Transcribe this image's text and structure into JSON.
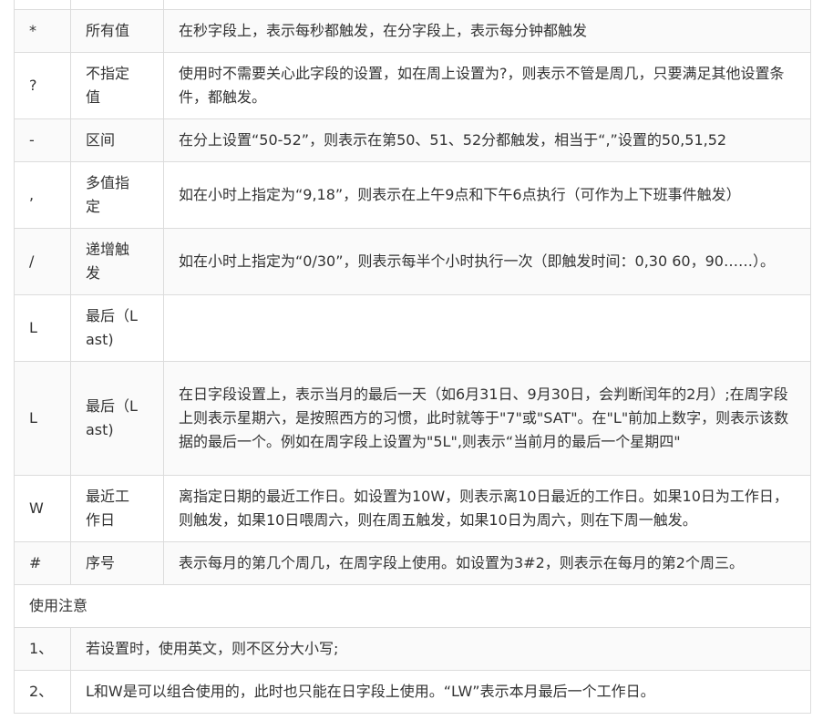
{
  "rows": [
    {
      "symbol": "",
      "name": "",
      "desc": ""
    },
    {
      "symbol": "*",
      "name": "所有值",
      "desc": "在秒字段上，表示每秒都触发，在分字段上，表示每分钟都触发"
    },
    {
      "symbol": "?",
      "name": "不指定值",
      "desc": "使用时不需要关心此字段的设置，如在周上设置为?，则表示不管是周几，只要满足其他设置条件，都触发。"
    },
    {
      "symbol": "-",
      "name": "区间",
      "desc": "在分上设置“50-52”，则表示在第50、51、52分都触发，相当于“,”设置的50,51,52"
    },
    {
      "symbol": ",",
      "name": "多值指定",
      "desc": "如在小时上指定为“9,18”，则表示在上午9点和下午6点执行（可作为上下班事件触发）"
    },
    {
      "symbol": "/",
      "name": "递增触发",
      "desc": "如在小时上指定为“0/30”，则表示每半个小时执行一次（即触发时间：0,30 60，90……）。"
    },
    {
      "symbol": "L",
      "name": "最后（Last)",
      "desc": ""
    },
    {
      "symbol": "L",
      "name": "最后（Last)",
      "desc": "在日字段设置上，表示当月的最后一天（如6月31日、9月30日，会判断闰年的2月）;在周字段上则表示星期六，是按照西方的习惯，此时就等于\"7\"或\"SAT\"。在\"L\"前加上数字，则表示该数据的最后一个。例如在周字段上设置为\"5L\",则表示“当前月的最后一个星期四\""
    },
    {
      "symbol": "W",
      "name": "最近工作日",
      "desc": "离指定日期的最近工作日。如设置为10W，则表示离10日最近的工作日。如果10日为工作日，则触发，如果10日喂周六，则在周五触发，如果10日为周六，则在下周一触发。"
    },
    {
      "symbol": "#",
      "name": "序号",
      "desc": "表示每月的第几个周几，在周字段上使用。如设置为3#2，则表示在每月的第2个周三。"
    }
  ],
  "notes": {
    "header": "使用注意",
    "items": [
      {
        "num": "1、",
        "text": "若设置时，使用英文，则不区分大小写;"
      },
      {
        "num": "2、",
        "text": "L和W是可以组合使用的，此时也只能在日字段上使用。“LW”表示本月最后一个工作日。"
      }
    ]
  }
}
